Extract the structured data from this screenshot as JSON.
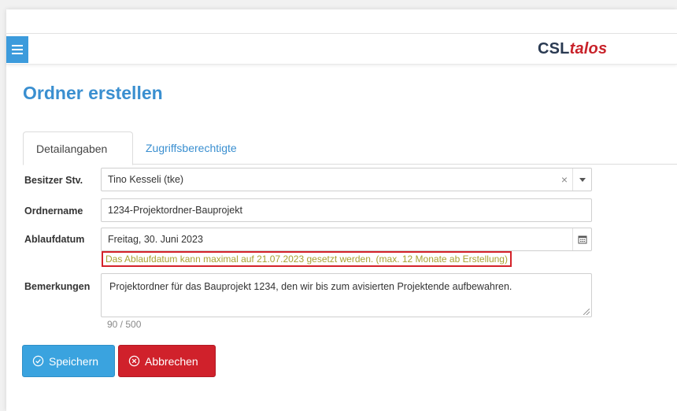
{
  "brand": {
    "part1": "CSL",
    "part2": "talos"
  },
  "page_title": "Ordner erstellen",
  "tabs": [
    {
      "label": "Detailangaben",
      "active": true
    },
    {
      "label": "Zugriffsberechtigte",
      "active": false
    }
  ],
  "form": {
    "owner": {
      "label": "Besitzer Stv.",
      "value": "Tino Kesseli (tke)",
      "clear": "×"
    },
    "folder_name": {
      "label": "Ordnername",
      "value": "1234-Projektordner-Bauprojekt"
    },
    "expiry": {
      "label": "Ablaufdatum",
      "value": "Freitag, 30. Juni 2023",
      "hint": "Das Ablaufdatum kann maximal auf 21.07.2023 gesetzt werden. (max. 12 Monate ab Erstellung)"
    },
    "remarks": {
      "label": "Bemerkungen",
      "value": "Projektordner für das Bauprojekt 1234, den wir bis zum avisierten Projektende aufbewahren.",
      "counter": "90 / 500"
    }
  },
  "buttons": {
    "save": "Speichern",
    "cancel": "Abbrechen"
  },
  "colors": {
    "accent": "#3a8fd0",
    "save": "#3aa3df",
    "cancel": "#d0212b",
    "hint_border": "#d4222a",
    "hint_text": "#a8a232"
  }
}
